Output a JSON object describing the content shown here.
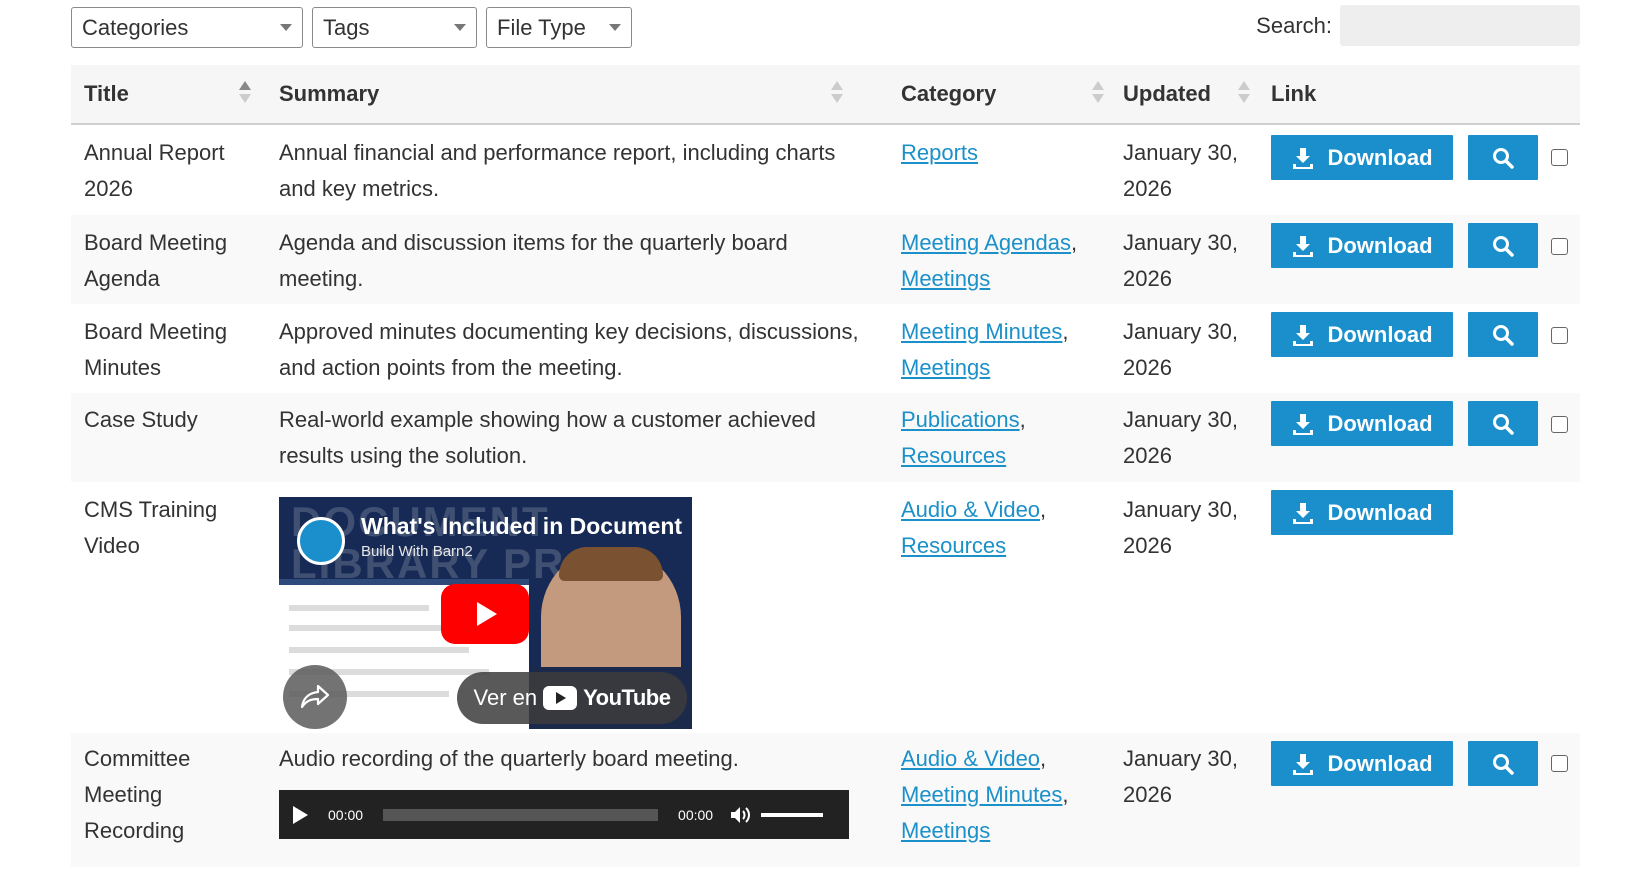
{
  "filters": {
    "categories": "Categories",
    "tags": "Tags",
    "file_type": "File Type",
    "search_label": "Search:"
  },
  "headers": {
    "title": "Title",
    "summary": "Summary",
    "category": "Category",
    "updated": "Updated",
    "link": "Link"
  },
  "button_label": "Download",
  "icons": {
    "download": "download-icon",
    "preview": "search-icon"
  },
  "colors": {
    "accent": "#1a8fcc",
    "link": "#1b90c9"
  },
  "rows": [
    {
      "title": "Annual Report 2026",
      "summary": "Annual financial and performance report, including charts and key metrics.",
      "categories": [
        "Reports"
      ],
      "updated": "January 30, 2026"
    },
    {
      "title": "Board Meeting Agenda",
      "summary": "Agenda and discussion items for the quarterly board meeting.",
      "categories": [
        "Meeting Agendas",
        "Meetings"
      ],
      "updated": "January 30, 2026"
    },
    {
      "title": "Board Meeting Minutes",
      "summary": "Approved minutes documenting key decisions, discussions, and action points from the meeting.",
      "categories": [
        "Meeting Minutes",
        "Meetings"
      ],
      "updated": "January 30, 2026"
    },
    {
      "title": "Case Study",
      "summary": "Real-world example showing how a customer achieved results using the solution.",
      "categories": [
        "Publications",
        "Resources"
      ],
      "updated": "January 30, 2026"
    },
    {
      "title": "CMS Training Video",
      "categories": [
        "Audio & Video",
        "Resources"
      ],
      "updated": "January 30, 2026",
      "video": {
        "ghost_text": "DOCUMENT LIBRARY PRO",
        "title": "What's Included in Document",
        "subtitle": "Build With Barn2",
        "watch_on": "Ver en",
        "platform": "YouTube"
      }
    },
    {
      "title": "Committee Meeting Recording",
      "summary": "Audio recording of the quarterly board meeting.",
      "categories": [
        "Audio & Video",
        "Meeting Minutes",
        "Meetings"
      ],
      "updated": "January 30, 2026",
      "audio": {
        "current_time": "00:00",
        "duration": "00:00"
      }
    }
  ]
}
